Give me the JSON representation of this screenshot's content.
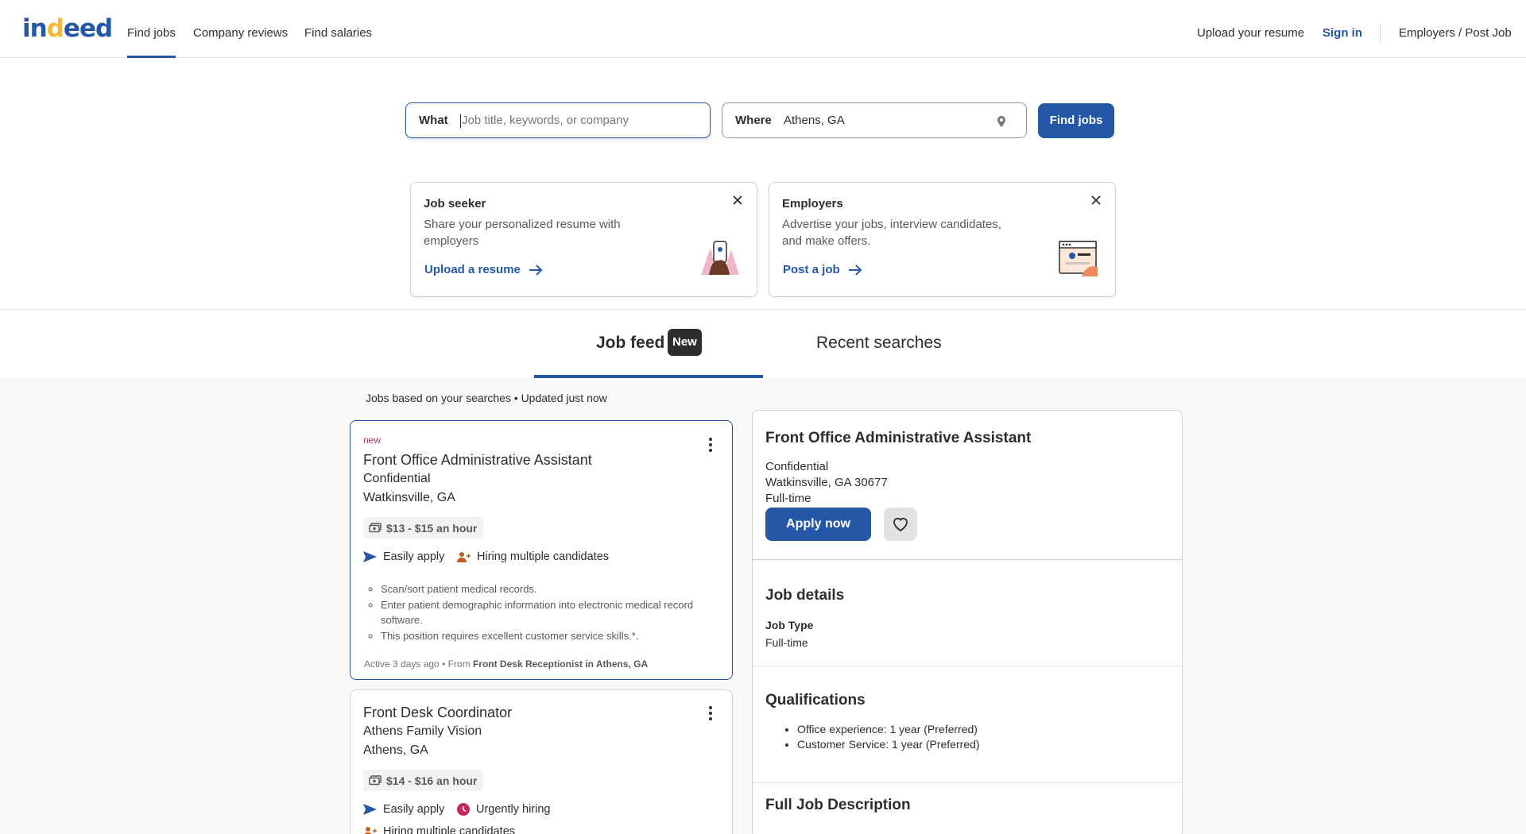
{
  "header": {
    "logo_text": "indeed",
    "nav": [
      "Find jobs",
      "Company reviews",
      "Find salaries"
    ],
    "upload_resume": "Upload your resume",
    "sign_in": "Sign in",
    "employers": "Employers / Post Job"
  },
  "search": {
    "what_label": "What",
    "what_placeholder": "Job title, keywords, or company",
    "what_value": "",
    "where_label": "Where",
    "where_value": "Athens, GA",
    "find_button": "Find jobs"
  },
  "promos": {
    "seeker": {
      "title": "Job seeker",
      "desc": "Share your personalized resume with employers",
      "link": "Upload a resume"
    },
    "employer": {
      "title": "Employers",
      "desc": "Advertise your jobs, interview candidates, and make offers.",
      "link": "Post a job"
    }
  },
  "tabs": {
    "feed": "Job feed",
    "feed_badge": "New",
    "recent": "Recent searches"
  },
  "feed_caption": "Jobs based on your searches • Updated just now",
  "jobs": [
    {
      "tag": "new",
      "title": "Front Office Administrative Assistant",
      "company": "Confidential",
      "location": "Watkinsville, GA",
      "salary": "$13 - $15 an hour",
      "attr1": "Easily apply",
      "attr2": "Hiring multiple candidates",
      "bullets": [
        "Scan/sort patient medical records.",
        "Enter patient demographic information into electronic medical record software.",
        "This position requires excellent customer service skills.*."
      ],
      "meta_prefix": "Active 3 days ago • From",
      "meta_source": "Front Desk Receptionist in Athens, GA"
    },
    {
      "title": "Front Desk Coordinator",
      "company": "Athens Family Vision",
      "location": "Athens, GA",
      "salary": "$14 - $16 an hour",
      "attr1": "Easily apply",
      "attr2": "Urgently hiring",
      "attr3": "Hiring multiple candidates"
    }
  ],
  "detail": {
    "title": "Front Office Administrative Assistant",
    "company": "Confidential",
    "location": "Watkinsville, GA 30677",
    "type": "Full-time",
    "apply": "Apply now",
    "job_details_heading": "Job details",
    "job_type_label": "Job Type",
    "job_type_value": "Full-time",
    "qualifications_heading": "Qualifications",
    "qualifications": [
      "Office experience: 1 year (Preferred)",
      "Customer Service: 1 year (Preferred)"
    ],
    "full_desc_heading": "Full Job Description"
  },
  "colors": {
    "brand_blue": "#2557a7",
    "logo_yellow": "#f5b82e",
    "new_tag": "#c8275e",
    "urgent": "#c8275e",
    "hiring": "#c25e1d"
  },
  "icons": [
    "map-pin-icon",
    "close-icon",
    "arrow-right-icon",
    "money-icon",
    "send-icon",
    "people-icon",
    "clock-icon",
    "heart-icon",
    "kebab-menu-icon"
  ]
}
